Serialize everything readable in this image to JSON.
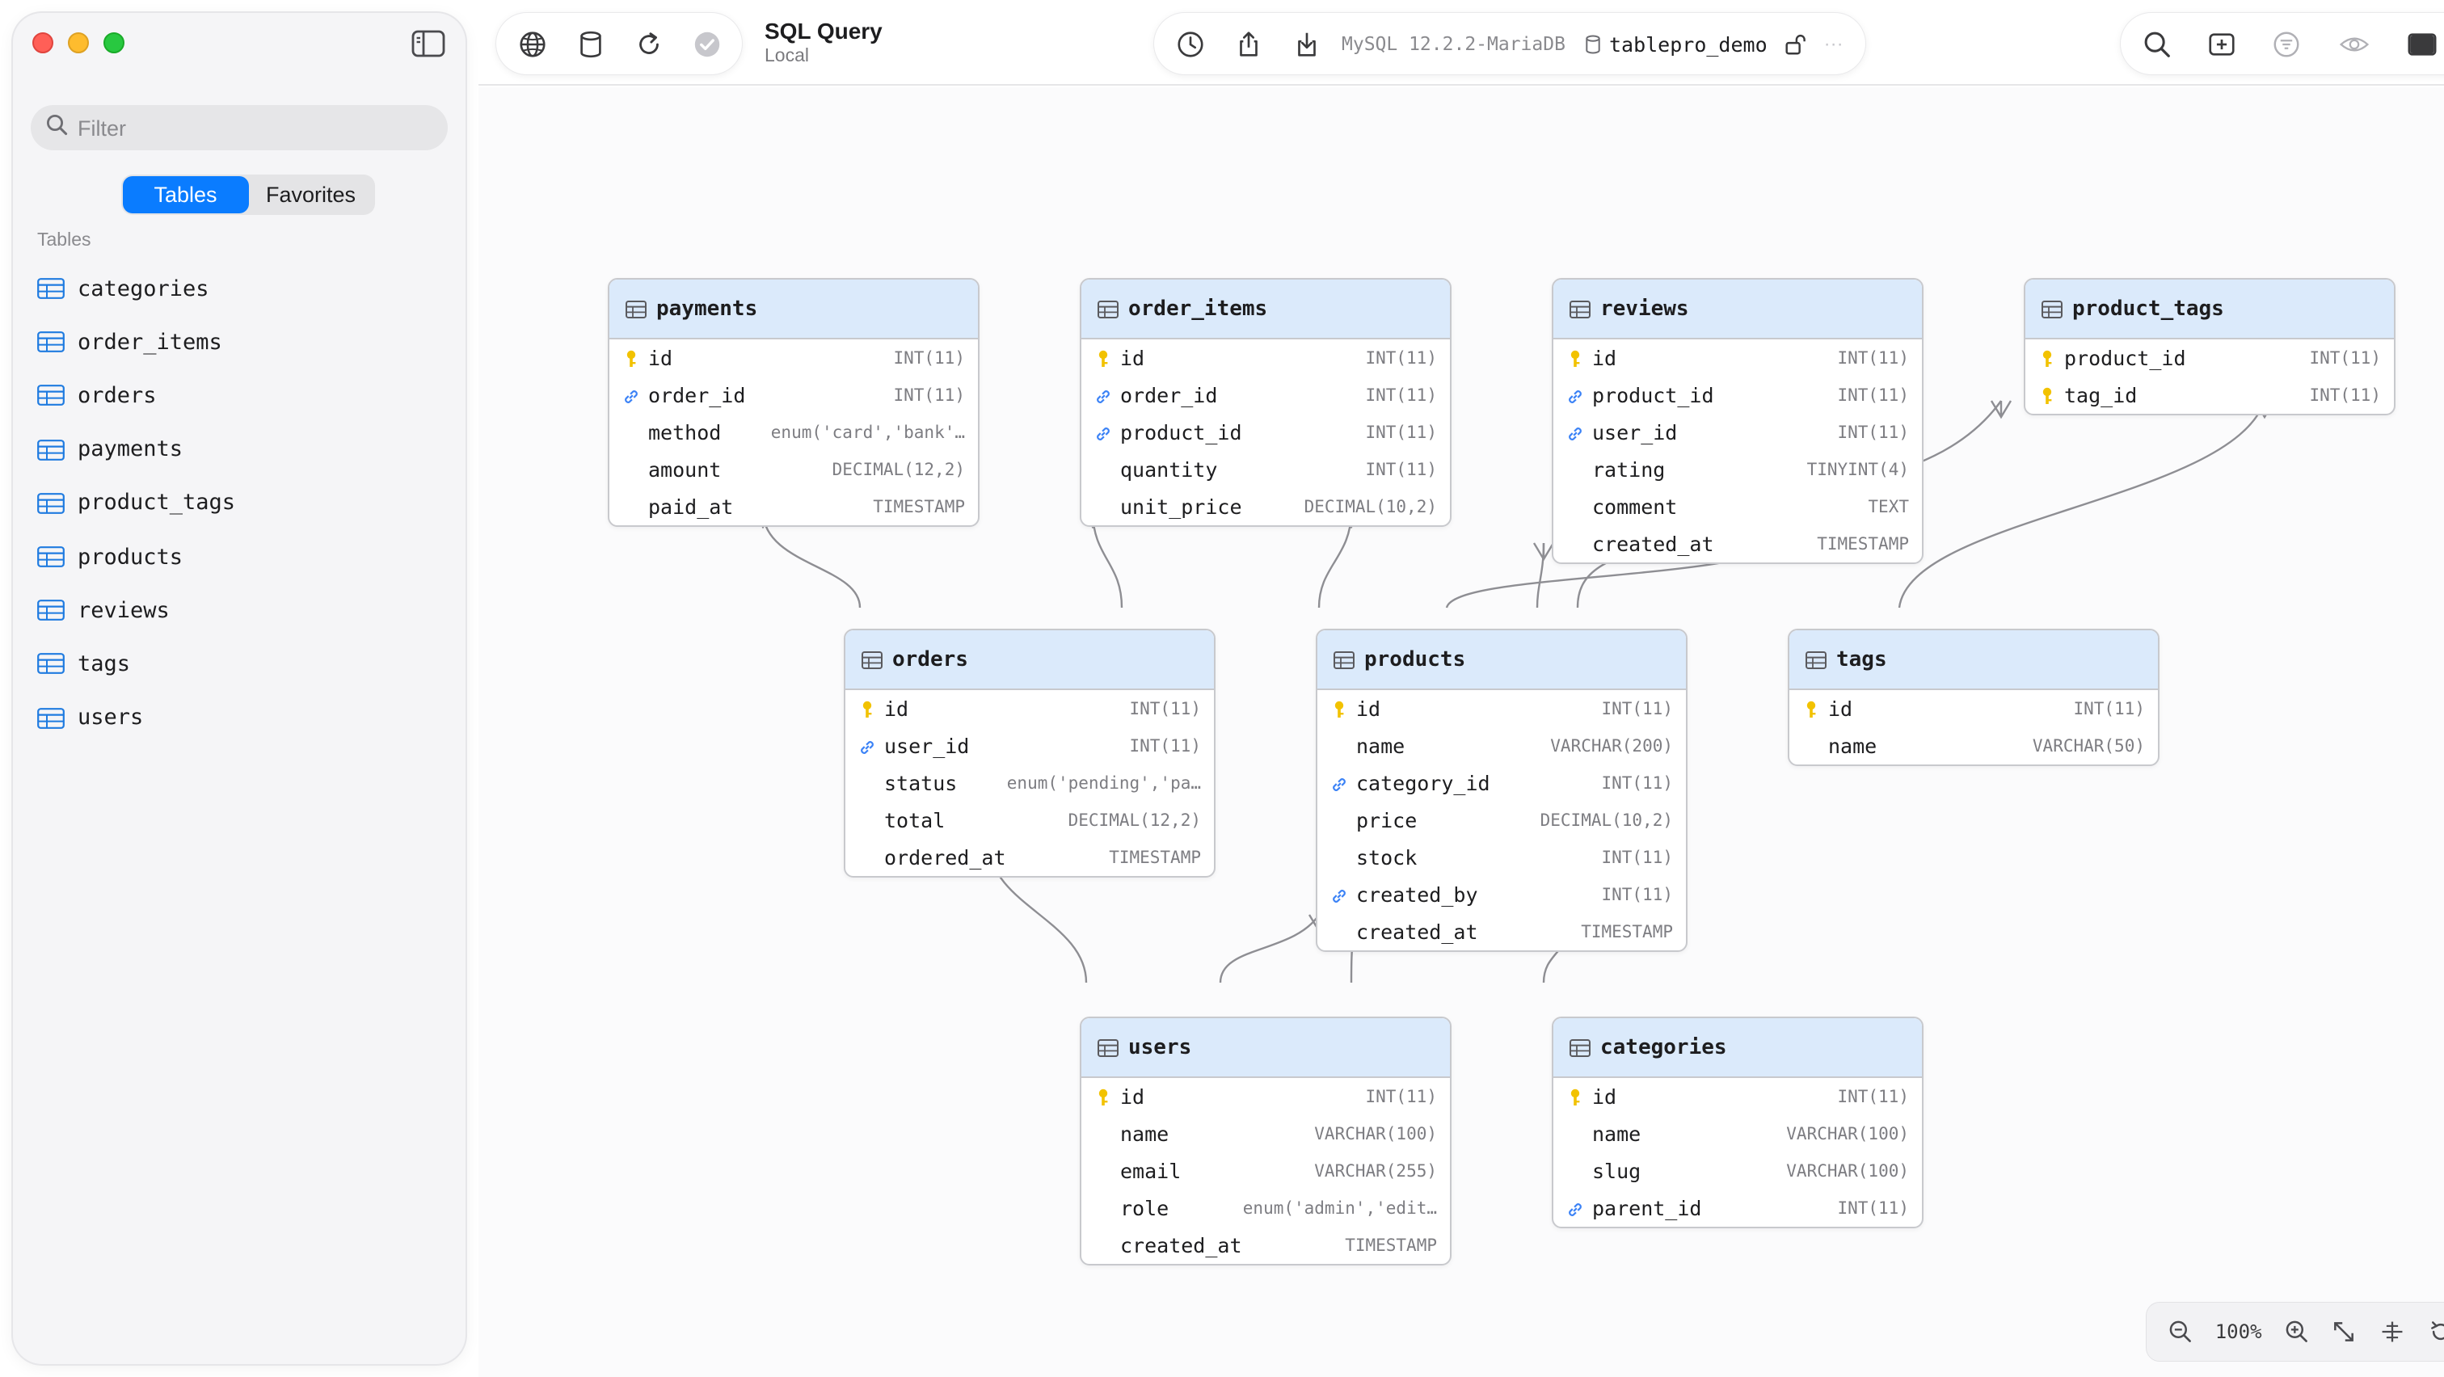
{
  "sidebar": {
    "filter_placeholder": "Filter",
    "segments": [
      "Tables",
      "Favorites"
    ],
    "active_segment": "Tables",
    "section_heading": "Tables",
    "tables": [
      "categories",
      "order_items",
      "orders",
      "payments",
      "product_tags",
      "products",
      "reviews",
      "tags",
      "users"
    ]
  },
  "toolbar": {
    "title": "SQL Query",
    "subtitle": "Local",
    "connection": "MySQL 12.2.2-MariaDB",
    "database": "tablepro_demo",
    "more": "···"
  },
  "diagram": {
    "tables": [
      {
        "id": "payments",
        "name": "payments",
        "columns": [
          {
            "name": "id",
            "type": "INT(11)",
            "key": "primary"
          },
          {
            "name": "order_id",
            "type": "INT(11)",
            "key": "foreign"
          },
          {
            "name": "method",
            "type": "enum('card','bank'…",
            "key": ""
          },
          {
            "name": "amount",
            "type": "DECIMAL(12,2)",
            "key": ""
          },
          {
            "name": "paid_at",
            "type": "TIMESTAMP",
            "key": ""
          }
        ]
      },
      {
        "id": "order_items",
        "name": "order_items",
        "columns": [
          {
            "name": "id",
            "type": "INT(11)",
            "key": "primary"
          },
          {
            "name": "order_id",
            "type": "INT(11)",
            "key": "foreign"
          },
          {
            "name": "product_id",
            "type": "INT(11)",
            "key": "foreign"
          },
          {
            "name": "quantity",
            "type": "INT(11)",
            "key": ""
          },
          {
            "name": "unit_price",
            "type": "DECIMAL(10,2)",
            "key": ""
          }
        ]
      },
      {
        "id": "reviews",
        "name": "reviews",
        "columns": [
          {
            "name": "id",
            "type": "INT(11)",
            "key": "primary"
          },
          {
            "name": "product_id",
            "type": "INT(11)",
            "key": "foreign"
          },
          {
            "name": "user_id",
            "type": "INT(11)",
            "key": "foreign"
          },
          {
            "name": "rating",
            "type": "TINYINT(4)",
            "key": ""
          },
          {
            "name": "comment",
            "type": "TEXT",
            "key": ""
          },
          {
            "name": "created_at",
            "type": "TIMESTAMP",
            "key": ""
          }
        ]
      },
      {
        "id": "product_tags",
        "name": "product_tags",
        "columns": [
          {
            "name": "product_id",
            "type": "INT(11)",
            "key": "primary"
          },
          {
            "name": "tag_id",
            "type": "INT(11)",
            "key": "primary"
          }
        ]
      },
      {
        "id": "orders",
        "name": "orders",
        "columns": [
          {
            "name": "id",
            "type": "INT(11)",
            "key": "primary"
          },
          {
            "name": "user_id",
            "type": "INT(11)",
            "key": "foreign"
          },
          {
            "name": "status",
            "type": "enum('pending','pa…",
            "key": ""
          },
          {
            "name": "total",
            "type": "DECIMAL(12,2)",
            "key": ""
          },
          {
            "name": "ordered_at",
            "type": "TIMESTAMP",
            "key": ""
          }
        ]
      },
      {
        "id": "products",
        "name": "products",
        "columns": [
          {
            "name": "id",
            "type": "INT(11)",
            "key": "primary"
          },
          {
            "name": "name",
            "type": "VARCHAR(200)",
            "key": ""
          },
          {
            "name": "category_id",
            "type": "INT(11)",
            "key": "foreign"
          },
          {
            "name": "price",
            "type": "DECIMAL(10,2)",
            "key": ""
          },
          {
            "name": "stock",
            "type": "INT(11)",
            "key": ""
          },
          {
            "name": "created_by",
            "type": "INT(11)",
            "key": "foreign"
          },
          {
            "name": "created_at",
            "type": "TIMESTAMP",
            "key": ""
          }
        ]
      },
      {
        "id": "tags",
        "name": "tags",
        "columns": [
          {
            "name": "id",
            "type": "INT(11)",
            "key": "primary"
          },
          {
            "name": "name",
            "type": "VARCHAR(50)",
            "key": ""
          }
        ]
      },
      {
        "id": "users",
        "name": "users",
        "columns": [
          {
            "name": "id",
            "type": "INT(11)",
            "key": "primary"
          },
          {
            "name": "name",
            "type": "VARCHAR(100)",
            "key": ""
          },
          {
            "name": "email",
            "type": "VARCHAR(255)",
            "key": ""
          },
          {
            "name": "role",
            "type": "enum('admin','edit…",
            "key": ""
          },
          {
            "name": "created_at",
            "type": "TIMESTAMP",
            "key": ""
          }
        ]
      },
      {
        "id": "categories",
        "name": "categories",
        "columns": [
          {
            "name": "id",
            "type": "INT(11)",
            "key": "primary"
          },
          {
            "name": "name",
            "type": "VARCHAR(100)",
            "key": ""
          },
          {
            "name": "slug",
            "type": "VARCHAR(100)",
            "key": ""
          },
          {
            "name": "parent_id",
            "type": "INT(11)",
            "key": "foreign"
          }
        ]
      }
    ]
  },
  "zoom": {
    "level": "100%"
  },
  "colors": {
    "accent": "#0a7cff",
    "header": "#dbeafb",
    "primary_key": "#f2c200",
    "foreign_key": "#3b82f6",
    "relation_line": "#8e8e93"
  }
}
